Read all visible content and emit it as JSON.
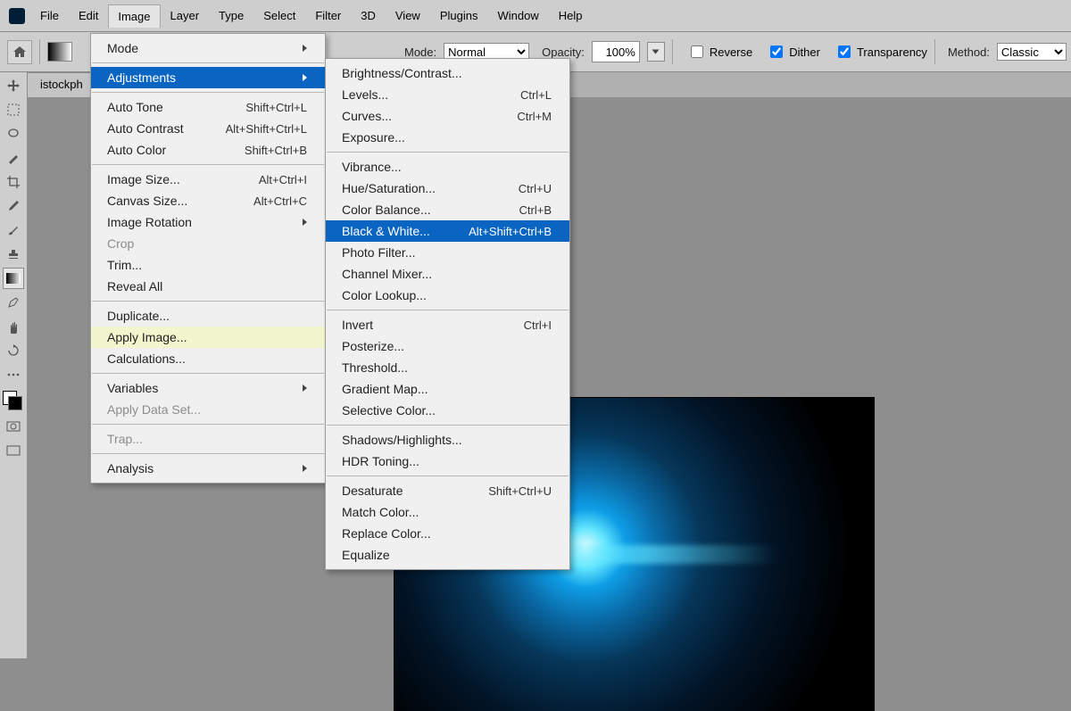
{
  "menubar": {
    "items": [
      "File",
      "Edit",
      "Image",
      "Layer",
      "Type",
      "Select",
      "Filter",
      "3D",
      "View",
      "Plugins",
      "Window",
      "Help"
    ],
    "active": "Image"
  },
  "optionsbar": {
    "mode_label": "Mode:",
    "mode_value": "Normal",
    "opacity_label": "Opacity:",
    "opacity_value": "100%",
    "reverse": {
      "label": "Reverse",
      "checked": false
    },
    "dither": {
      "label": "Dither",
      "checked": true
    },
    "transparency": {
      "label": "Transparency",
      "checked": true
    },
    "method_label": "Method:",
    "method_value": "Classic"
  },
  "document_tab": "istockph",
  "image_menu": {
    "mode": "Mode",
    "adjustments": "Adjustments",
    "auto_tone": {
      "l": "Auto Tone",
      "k": "Shift+Ctrl+L"
    },
    "auto_contrast": {
      "l": "Auto Contrast",
      "k": "Alt+Shift+Ctrl+L"
    },
    "auto_color": {
      "l": "Auto Color",
      "k": "Shift+Ctrl+B"
    },
    "image_size": {
      "l": "Image Size...",
      "k": "Alt+Ctrl+I"
    },
    "canvas_size": {
      "l": "Canvas Size...",
      "k": "Alt+Ctrl+C"
    },
    "image_rotation": "Image Rotation",
    "crop": "Crop",
    "trim": "Trim...",
    "reveal_all": "Reveal All",
    "duplicate": "Duplicate...",
    "apply_image": "Apply Image...",
    "calculations": "Calculations...",
    "variables": "Variables",
    "apply_data_set": "Apply Data Set...",
    "trap": "Trap...",
    "analysis": "Analysis"
  },
  "adjustments_menu": {
    "brightness": "Brightness/Contrast...",
    "levels": {
      "l": "Levels...",
      "k": "Ctrl+L"
    },
    "curves": {
      "l": "Curves...",
      "k": "Ctrl+M"
    },
    "exposure": "Exposure...",
    "vibrance": "Vibrance...",
    "hue": {
      "l": "Hue/Saturation...",
      "k": "Ctrl+U"
    },
    "color_balance": {
      "l": "Color Balance...",
      "k": "Ctrl+B"
    },
    "black_white": {
      "l": "Black & White...",
      "k": "Alt+Shift+Ctrl+B"
    },
    "photo_filter": "Photo Filter...",
    "channel_mixer": "Channel Mixer...",
    "color_lookup": "Color Lookup...",
    "invert": {
      "l": "Invert",
      "k": "Ctrl+I"
    },
    "posterize": "Posterize...",
    "threshold": "Threshold...",
    "gradient_map": "Gradient Map...",
    "selective_color": "Selective Color...",
    "shadows": "Shadows/Highlights...",
    "hdr": "HDR Toning...",
    "desaturate": {
      "l": "Desaturate",
      "k": "Shift+Ctrl+U"
    },
    "match_color": "Match Color...",
    "replace_color": "Replace Color...",
    "equalize": "Equalize"
  }
}
